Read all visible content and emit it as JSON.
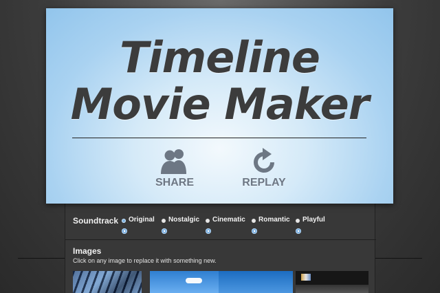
{
  "app": {
    "title_line1": "Timeline",
    "title_line2": "Movie Maker"
  },
  "actions": {
    "share": {
      "label": "SHARE",
      "icon": "people-icon"
    },
    "replay": {
      "label": "REPLAY",
      "icon": "replay-icon"
    }
  },
  "soundtrack": {
    "label": "Soundtrack",
    "selected": "Original",
    "options": [
      {
        "label": "Original"
      },
      {
        "label": "Nostalgic"
      },
      {
        "label": "Cinematic"
      },
      {
        "label": "Romantic"
      },
      {
        "label": "Playful"
      }
    ]
  },
  "images": {
    "title": "Images",
    "hint": "Click on any image to replace it with something new."
  },
  "colors": {
    "accent": "#7fb3e0",
    "card_blue": "#92c5ec",
    "title_text": "#3c3c3c",
    "action_text": "#6d7784"
  }
}
